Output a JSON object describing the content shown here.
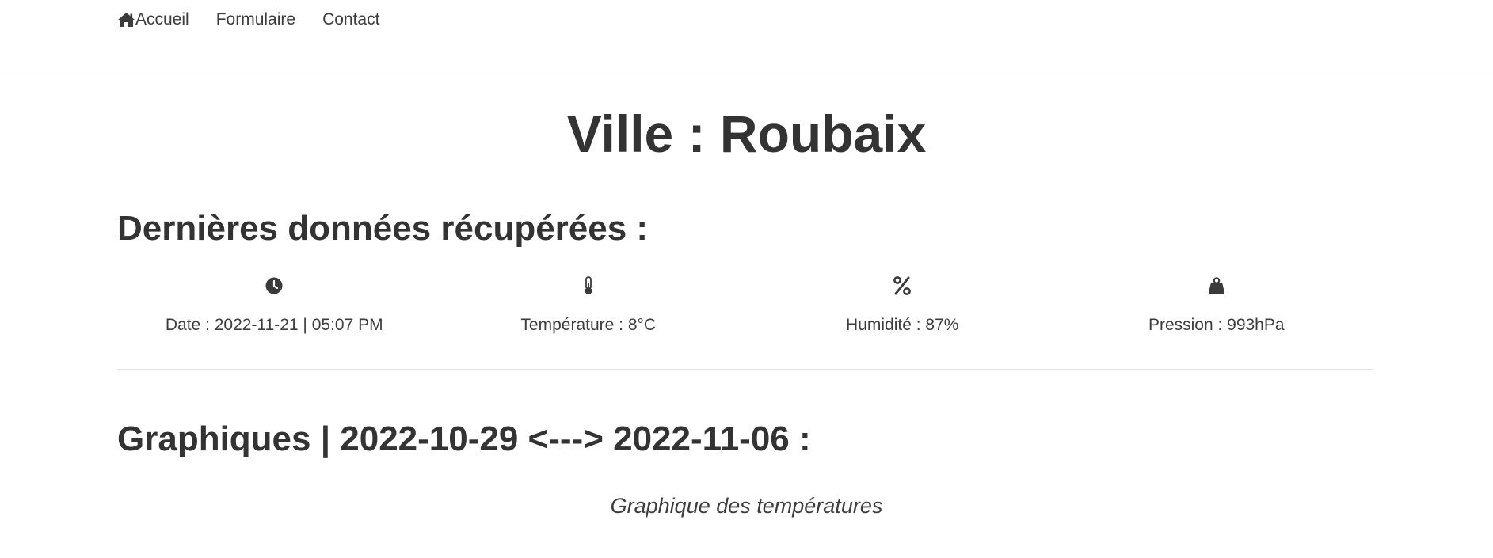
{
  "nav": {
    "items": [
      {
        "label": "Accueil",
        "icon": "home-icon"
      },
      {
        "label": "Formulaire"
      },
      {
        "label": "Contact"
      }
    ]
  },
  "city": {
    "title": "Ville : Roubaix"
  },
  "latest": {
    "title": "Dernières données récupérées :",
    "stats": [
      {
        "icon": "clock-icon",
        "text": "Date : 2022-11-21 | 05:07 PM"
      },
      {
        "icon": "thermometer-icon",
        "text": "Température : 8°C"
      },
      {
        "icon": "percent-icon",
        "text": "Humidité : 87%"
      },
      {
        "icon": "weight-icon",
        "text": "Pression : 993hPa"
      }
    ]
  },
  "graphs": {
    "title": "Graphiques | 2022-10-29 <---> 2022-11-06 :",
    "temperature_caption": "Graphique des températures"
  },
  "colors": {
    "text": "#333333",
    "divider": "#e4e4e4",
    "background": "#ffffff"
  }
}
